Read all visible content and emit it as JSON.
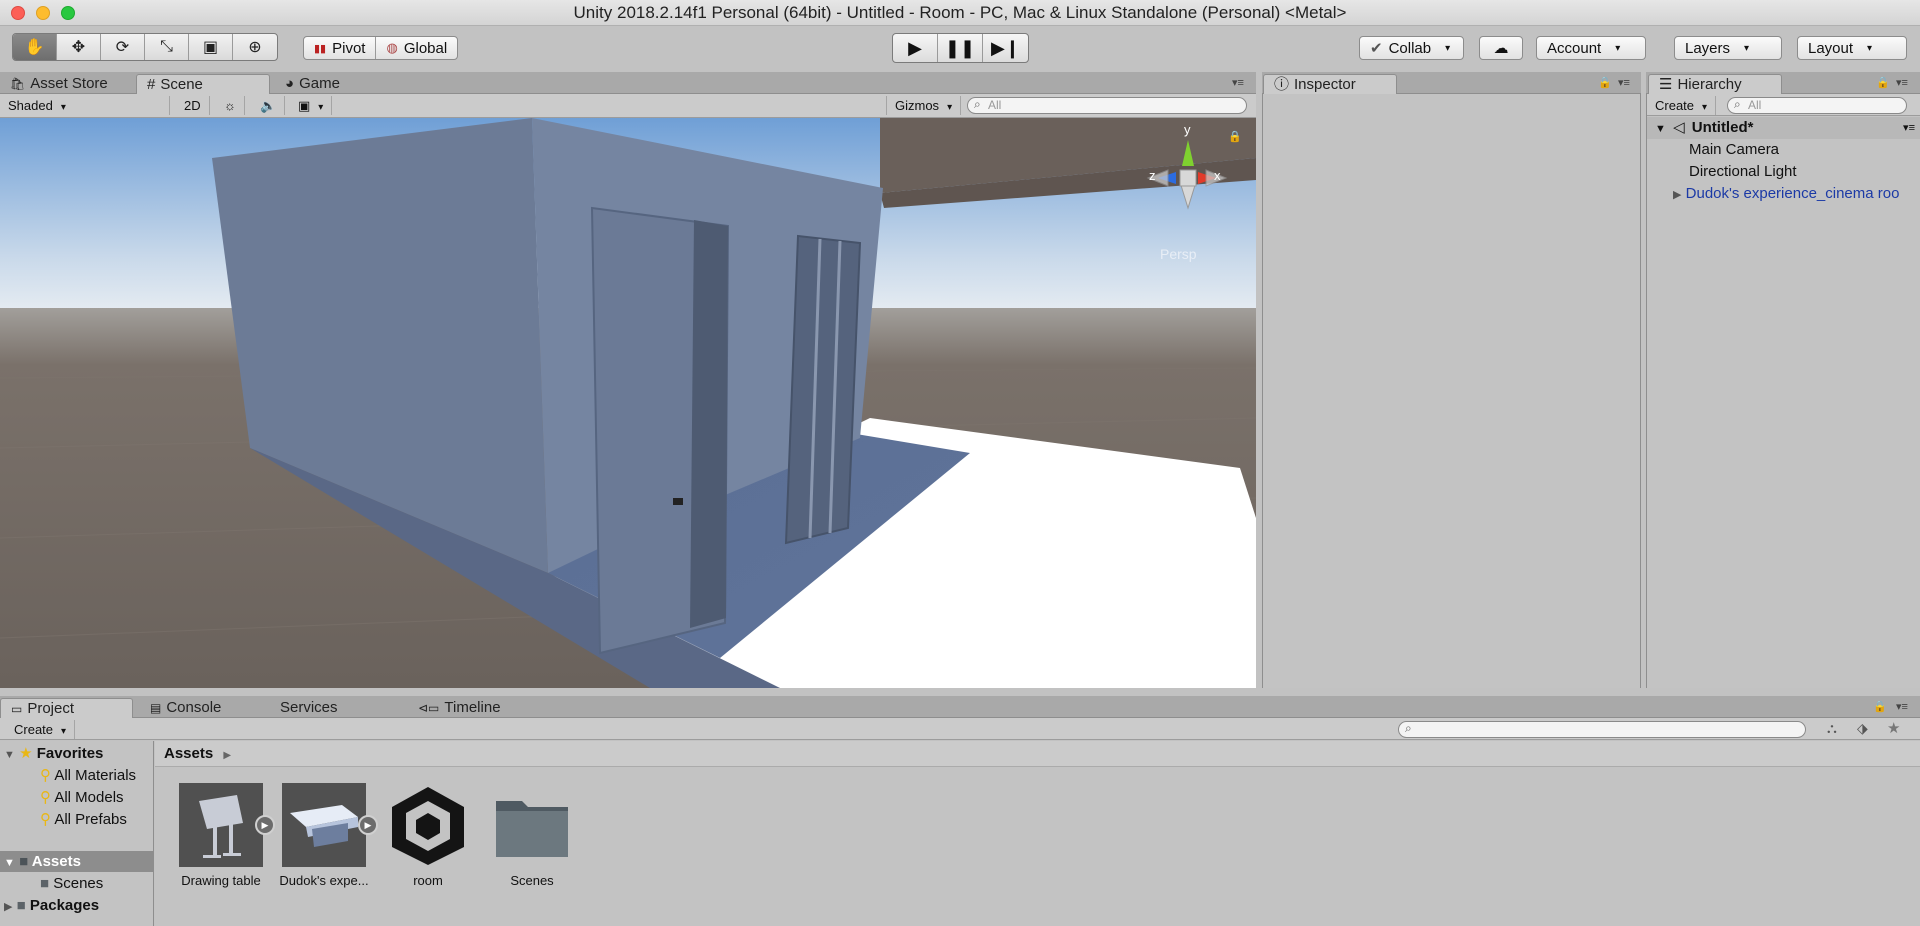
{
  "window": {
    "title": "Unity 2018.2.14f1 Personal (64bit) - Untitled - Room - PC, Mac & Linux Standalone (Personal) <Metal>"
  },
  "toolbar": {
    "tools": [
      "hand-icon",
      "move-icon",
      "rotate-icon",
      "scale-icon",
      "rect-transform-icon",
      "transform-icon"
    ],
    "pivot_label": "Pivot",
    "global_label": "Global",
    "collab_label": "Collab",
    "account_label": "Account",
    "layers_label": "Layers",
    "layout_label": "Layout"
  },
  "top_tabs": {
    "asset_store": "Asset Store",
    "scene": "Scene",
    "game": "Game",
    "inspector": "Inspector",
    "hierarchy": "Hierarchy"
  },
  "scene_bar": {
    "shading_mode": "Shaded",
    "mode_2d": "2D",
    "gizmos_label": "Gizmos",
    "search_placeholder": "All"
  },
  "gizmo": {
    "y_label": "y",
    "x_label": "x",
    "z_label": "z",
    "projection": "Persp"
  },
  "hierarchy": {
    "create_label": "Create",
    "search_placeholder": "All",
    "scene_name": "Untitled*",
    "items": [
      "Main Camera",
      "Directional Light",
      "Dudok's experience_cinema roo"
    ]
  },
  "bottom_tabs": {
    "project": "Project",
    "console": "Console",
    "services": "Services",
    "timeline": "Timeline"
  },
  "project": {
    "create_label": "Create",
    "favorites_label": "Favorites",
    "favorites": [
      "All Materials",
      "All Models",
      "All Prefabs"
    ],
    "assets_label": "Assets",
    "assets_children": [
      "Scenes"
    ],
    "packages_label": "Packages",
    "breadcrumb": "Assets",
    "asset_items": [
      {
        "label": "Drawing table"
      },
      {
        "label": "Dudok's expe..."
      },
      {
        "label": "room"
      },
      {
        "label": "Scenes"
      }
    ]
  },
  "colors": {
    "sky": "#a4c2e2",
    "ground": "#6a625c",
    "wall": "#6f7f9a",
    "floor_light": "#ffffff",
    "selection": "#1c3aa6"
  }
}
